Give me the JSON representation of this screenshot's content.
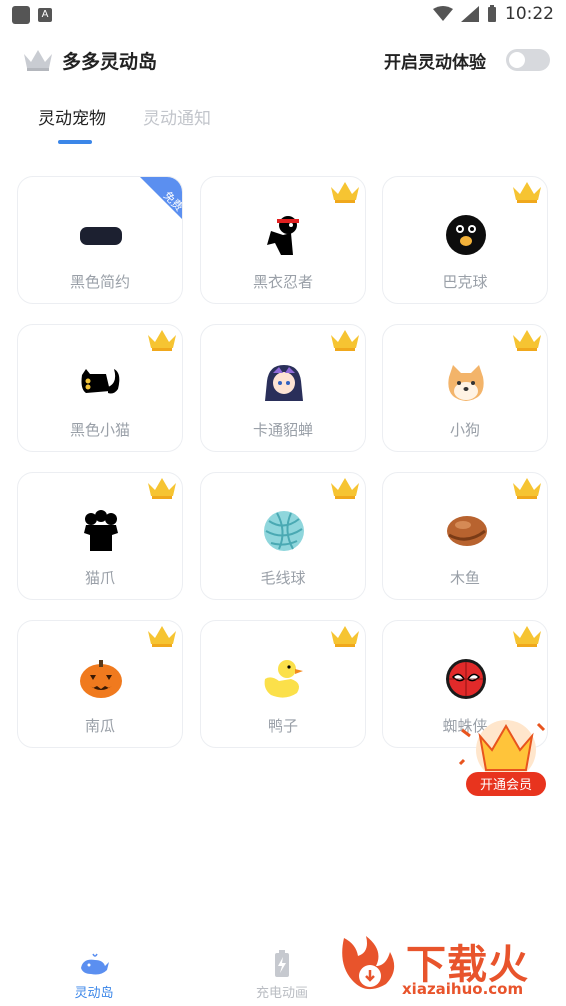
{
  "status_bar": {
    "time": "10:22"
  },
  "header": {
    "title": "多多灵动岛",
    "toggle_label": "开启灵动体验",
    "toggle_on": false
  },
  "tabs": [
    {
      "label": "灵动宠物",
      "active": true
    },
    {
      "label": "灵动通知",
      "active": false
    }
  ],
  "pets": [
    {
      "label": "黑色简约",
      "badge": "免费",
      "icon": "black-pill-icon"
    },
    {
      "label": "黑衣忍者",
      "badge": "vip",
      "icon": "ninja-icon"
    },
    {
      "label": "巴克球",
      "badge": "vip",
      "icon": "black-ball-icon"
    },
    {
      "label": "黑色小猫",
      "badge": "vip",
      "icon": "black-cat-icon"
    },
    {
      "label": "卡通貂蝉",
      "badge": "vip",
      "icon": "cartoon-girl-icon"
    },
    {
      "label": "小狗",
      "badge": "vip",
      "icon": "dog-icon"
    },
    {
      "label": "猫爪",
      "badge": "vip",
      "icon": "cat-paw-icon"
    },
    {
      "label": "毛线球",
      "badge": "vip",
      "icon": "yarn-ball-icon"
    },
    {
      "label": "木鱼",
      "badge": "vip",
      "icon": "wooden-fish-icon"
    },
    {
      "label": "南瓜",
      "badge": "vip",
      "icon": "pumpkin-icon"
    },
    {
      "label": "鸭子",
      "badge": "vip",
      "icon": "duck-icon"
    },
    {
      "label": "蜘蛛侠",
      "badge": "vip",
      "icon": "spiderman-icon"
    }
  ],
  "promo": {
    "label": "开通会员"
  },
  "bottom_nav": [
    {
      "label": "灵动岛",
      "active": true,
      "icon": "whale-icon"
    },
    {
      "label": "充电动画",
      "active": false,
      "icon": "battery-icon"
    }
  ],
  "watermark": {
    "text": "下载火",
    "url": "xiazaihuo.com"
  },
  "colors": {
    "accent": "#3b86e8",
    "vip_gold": "#f6c432",
    "watermark": "#e8542c"
  }
}
